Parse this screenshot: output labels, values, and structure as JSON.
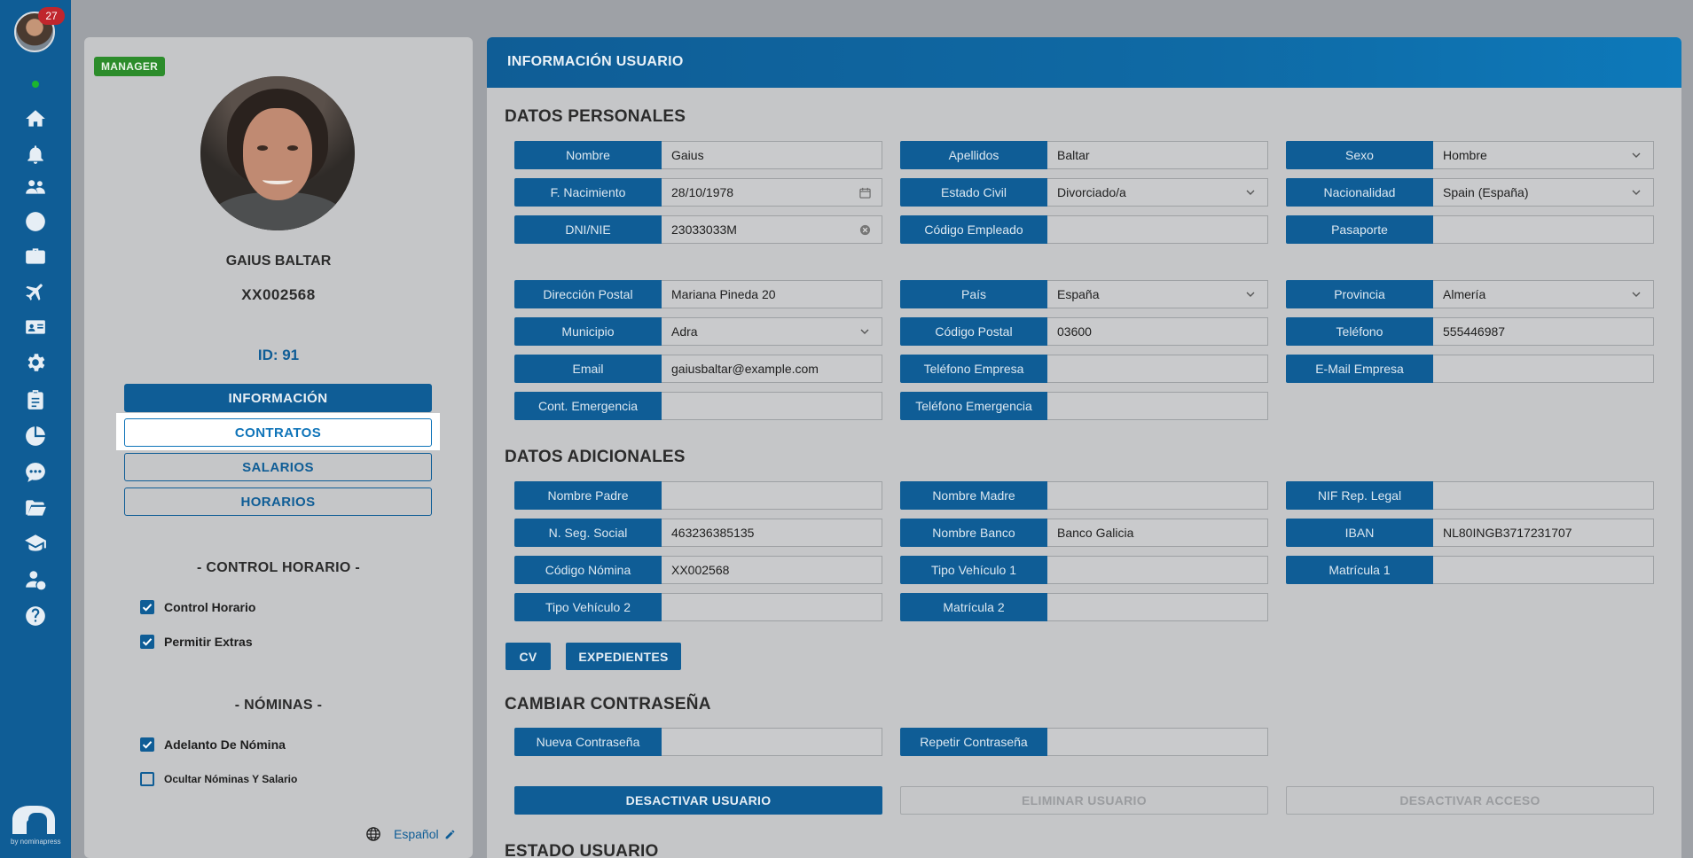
{
  "rail": {
    "notification_count": "27",
    "icons": [
      "home-icon",
      "bell-icon",
      "users-icon",
      "clock-icon",
      "briefcase-icon",
      "plane-icon",
      "id-card-icon",
      "gear-icon",
      "clipboard-icon",
      "pie-chart-icon",
      "chat-icon",
      "folder-icon",
      "graduation-cap-icon",
      "user-money-icon",
      "help-icon"
    ],
    "brand_text": "by nominapress"
  },
  "profile": {
    "role": "MANAGER",
    "name": "GAIUS BALTAR",
    "code": "XX002568",
    "id_label": "ID: 91",
    "nav": [
      "INFORMACIÓN",
      "CONTRATOS",
      "SALARIOS",
      "HORARIOS"
    ],
    "control_title": "- CONTROL HORARIO -",
    "control_checks": [
      {
        "label": "Control Horario",
        "checked": true
      },
      {
        "label": "Permitir Extras",
        "checked": true
      }
    ],
    "nominas_title": "- NÓMINAS -",
    "nominas_checks": [
      {
        "label": "Adelanto De Nómina",
        "checked": true
      },
      {
        "label": "Ocultar Nóminas Y Salario",
        "checked": false
      }
    ],
    "language": "Español"
  },
  "main": {
    "header": "INFORMACIÓN USUARIO",
    "personal_title": "DATOS PERSONALES",
    "personal": {
      "nombre": {
        "label": "Nombre",
        "value": "Gaius"
      },
      "apellidos": {
        "label": "Apellidos",
        "value": "Baltar"
      },
      "sexo": {
        "label": "Sexo",
        "value": "Hombre"
      },
      "nacimiento": {
        "label": "F. Nacimiento",
        "value": "28/10/1978"
      },
      "estado_civil": {
        "label": "Estado Civil",
        "value": "Divorciado/a"
      },
      "nacionalidad": {
        "label": "Nacionalidad",
        "value": "Spain (España)"
      },
      "dni": {
        "label": "DNI/NIE",
        "value": "23033033M"
      },
      "codigo_empleado": {
        "label": "Código Empleado",
        "value": ""
      },
      "pasaporte": {
        "label": "Pasaporte",
        "value": ""
      },
      "direccion": {
        "label": "Dirección Postal",
        "value": "Mariana Pineda 20"
      },
      "pais": {
        "label": "País",
        "value": "España"
      },
      "provincia": {
        "label": "Provincia",
        "value": "Almería"
      },
      "municipio": {
        "label": "Municipio",
        "value": "Adra"
      },
      "codigo_postal": {
        "label": "Código Postal",
        "value": "03600"
      },
      "telefono": {
        "label": "Teléfono",
        "value": "555446987"
      },
      "email": {
        "label": "Email",
        "value": "gaiusbaltar@example.com"
      },
      "telefono_empresa": {
        "label": "Teléfono Empresa",
        "value": ""
      },
      "email_empresa": {
        "label": "E-Mail Empresa",
        "value": ""
      },
      "cont_emergencia": {
        "label": "Cont. Emergencia",
        "value": ""
      },
      "telefono_emergencia": {
        "label": "Teléfono Emergencia",
        "value": ""
      }
    },
    "additional_title": "DATOS ADICIONALES",
    "additional": {
      "nombre_padre": {
        "label": "Nombre Padre",
        "value": ""
      },
      "nombre_madre": {
        "label": "Nombre Madre",
        "value": ""
      },
      "nif_rep_legal": {
        "label": "NIF Rep. Legal",
        "value": ""
      },
      "seg_social": {
        "label": "N. Seg. Social",
        "value": "463236385135"
      },
      "nombre_banco": {
        "label": "Nombre Banco",
        "value": "Banco Galicia"
      },
      "iban": {
        "label": "IBAN",
        "value": "NL80INGB3717231707"
      },
      "codigo_nomina": {
        "label": "Código Nómina",
        "value": "XX002568"
      },
      "tipo_vehiculo_1": {
        "label": "Tipo Vehículo 1",
        "value": ""
      },
      "matricula_1": {
        "label": "Matrícula 1",
        "value": ""
      },
      "tipo_vehiculo_2": {
        "label": "Tipo Vehículo 2",
        "value": ""
      },
      "matricula_2": {
        "label": "Matrícula 2",
        "value": ""
      }
    },
    "buttons": {
      "cv": "CV",
      "expedientes": "EXPEDIENTES"
    },
    "password_title": "CAMBIAR CONTRASEÑA",
    "password": {
      "nueva": {
        "label": "Nueva Contraseña",
        "value": ""
      },
      "repetir": {
        "label": "Repetir Contraseña",
        "value": ""
      }
    },
    "actions": {
      "desactivar_usuario": "DESACTIVAR USUARIO",
      "eliminar_usuario": "ELIMINAR USUARIO",
      "desactivar_acceso": "DESACTIVAR ACCESO"
    },
    "estado_title": "ESTADO USUARIO"
  },
  "colors": {
    "primary": "#0f5d96",
    "badge": "#c0262d",
    "role": "#2c8c2b",
    "online": "#1bb52f"
  }
}
